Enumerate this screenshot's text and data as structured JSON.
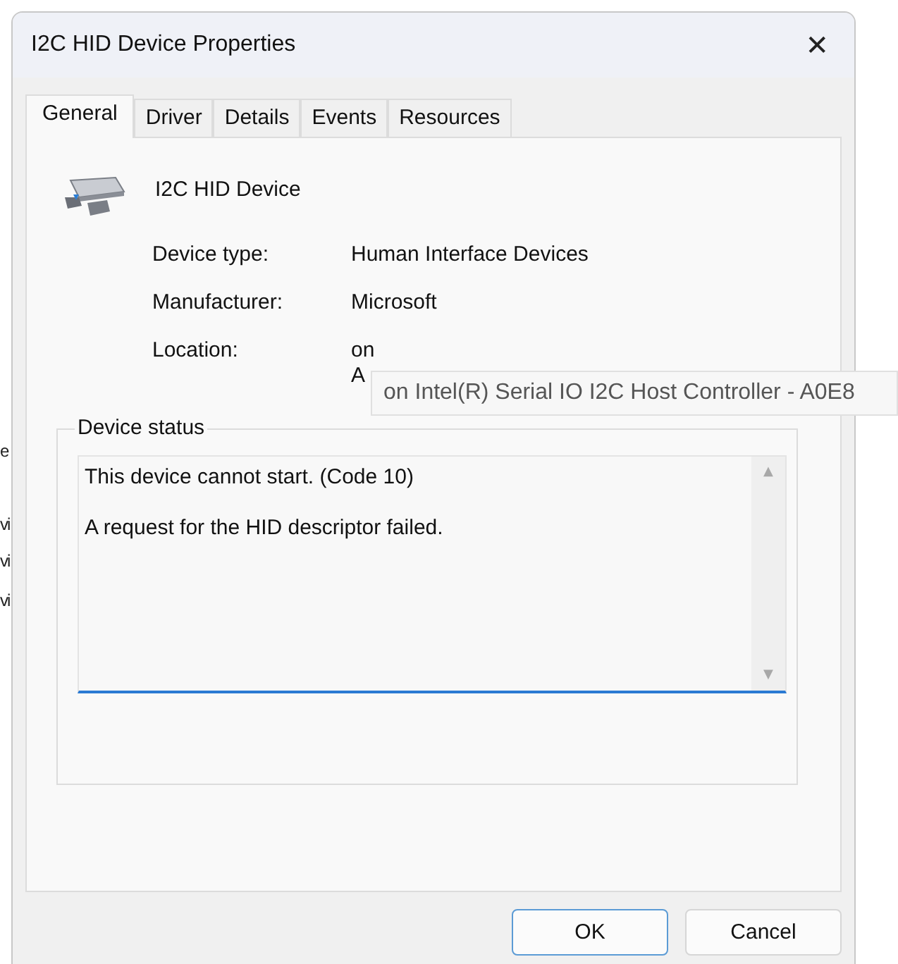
{
  "background_fragments": [
    "e",
    "vi",
    "vi",
    "vi"
  ],
  "window": {
    "title": "I2C HID Device Properties",
    "close": "✕"
  },
  "tabs": [
    {
      "label": "General",
      "selected": true
    },
    {
      "label": "Driver",
      "selected": false
    },
    {
      "label": "Details",
      "selected": false
    },
    {
      "label": "Events",
      "selected": false
    },
    {
      "label": "Resources",
      "selected": false
    }
  ],
  "device": {
    "name": "I2C HID Device"
  },
  "properties": [
    {
      "label": "Device type:",
      "value": [
        "Human Interface Devices"
      ]
    },
    {
      "label": "Manufacturer:",
      "value": [
        "Microsoft"
      ]
    },
    {
      "label": "Location:",
      "value": [
        "on",
        "A"
      ]
    }
  ],
  "tooltip": "on Intel(R) Serial IO I2C Host Controller - A0E8",
  "device_status": {
    "title": "Device status",
    "lines": [
      "This device cannot start. (Code 10)",
      "A request for the HID descriptor failed."
    ],
    "scroll_up": "▲",
    "scroll_down": "▼"
  },
  "buttons": [
    {
      "label": "OK",
      "default": true
    },
    {
      "label": "Cancel",
      "default": false
    }
  ]
}
